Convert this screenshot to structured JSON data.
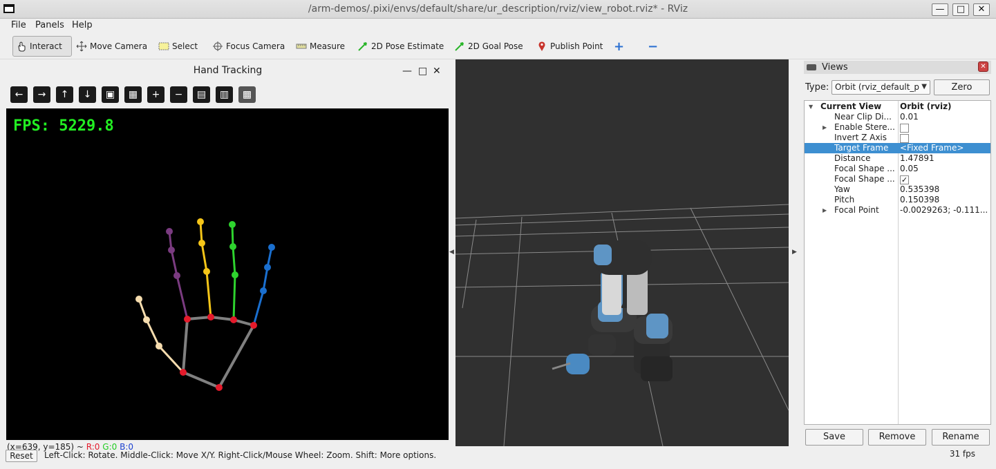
{
  "window": {
    "title": "/arm-demos/.pixi/envs/default/share/ur_description/rviz/view_robot.rviz* - RViz",
    "minimize_glyph": "—",
    "maximize_glyph": "□",
    "close_glyph": "✕"
  },
  "menu": {
    "file": "File",
    "panels": "Panels",
    "help": "Help"
  },
  "toolbar": {
    "interact": "Interact",
    "move_camera": "Move Camera",
    "select": "Select",
    "focus_camera": "Focus Camera",
    "measure": "Measure",
    "pose_estimate": "2D Pose Estimate",
    "goal_pose": "2D Goal Pose",
    "publish_point": "Publish Point",
    "add_glyph": "+",
    "remove_glyph": "−"
  },
  "hand_panel": {
    "title": "Hand Tracking",
    "fps_text": "FPS: 5229.8",
    "coords_prefix": "(x=639, y=185) ~ ",
    "r_text": "R:0",
    "g_text": "G:0",
    "b_text": "B:0",
    "glyphs": {
      "min": "—",
      "max": "□",
      "close": "✕"
    },
    "buttons": [
      "←",
      "→",
      "↑",
      "↓",
      "▣",
      "▦",
      "+",
      "−",
      "▤",
      "▥",
      "▩"
    ]
  },
  "views": {
    "title": "Views",
    "close_glyph": "✕",
    "type_label": "Type:",
    "type_value": "Orbit (rviz_default_p",
    "zero_button": "Zero",
    "properties": [
      {
        "name": "Current View",
        "value": "Orbit (rviz)",
        "level": 0,
        "expand": "open",
        "bold": true
      },
      {
        "name": "Near Clip Di...",
        "value": "0.01",
        "level": 1
      },
      {
        "name": "Enable Stere...",
        "value": "",
        "level": 1,
        "expand": "closed",
        "checkbox": false
      },
      {
        "name": "Invert Z Axis",
        "value": "",
        "level": 1,
        "checkbox": false
      },
      {
        "name": "Target Frame",
        "value": "<Fixed Frame>",
        "level": 1,
        "selected": true
      },
      {
        "name": "Distance",
        "value": "1.47891",
        "level": 1
      },
      {
        "name": "Focal Shape ...",
        "value": "0.05",
        "level": 1
      },
      {
        "name": "Focal Shape ...",
        "value": "",
        "level": 1,
        "checkbox": true
      },
      {
        "name": "Yaw",
        "value": "0.535398",
        "level": 1
      },
      {
        "name": "Pitch",
        "value": "0.150398",
        "level": 1
      },
      {
        "name": "Focal Point",
        "value": "-0.0029263; -0.111...",
        "level": 1,
        "expand": "closed"
      }
    ],
    "save": "Save",
    "remove": "Remove",
    "rename": "Rename"
  },
  "status": {
    "reset": "Reset",
    "hint": "Left-Click: Rotate. Middle-Click: Move X/Y. Right-Click/Mouse Wheel: Zoom. Shift: More options.",
    "fps": "31 fps"
  },
  "colors": {
    "fps_green": "#22ee22",
    "palm": "#808080",
    "joint_red": "#e41a2b",
    "thumb": "#f5dcae",
    "index": "#7a3b80",
    "middle": "#f5c518",
    "ring": "#2ed32e",
    "pinky": "#1a6fcf",
    "selection": "#3d8fd1",
    "viewport_bg": "#303030"
  }
}
